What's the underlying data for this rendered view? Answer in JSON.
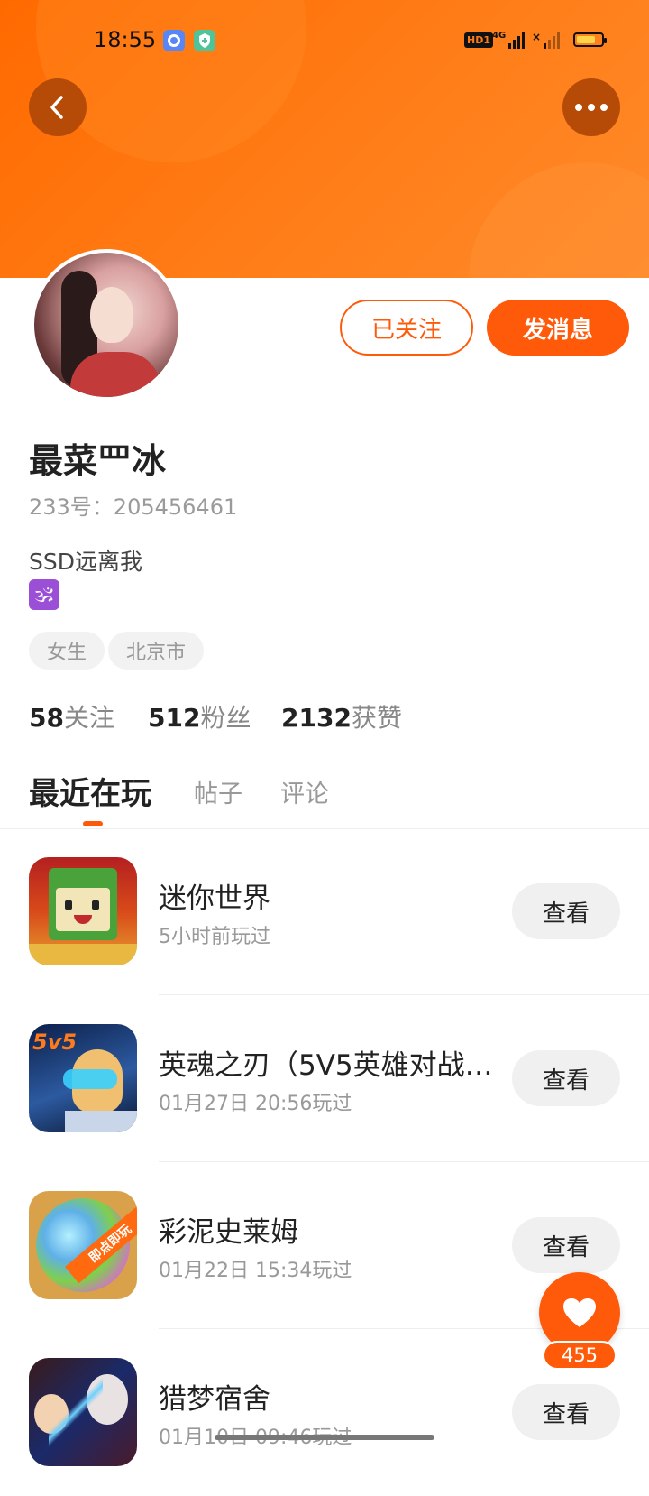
{
  "status_bar": {
    "time": "18:55",
    "hd_label": "HD1",
    "network": "4G",
    "battery_level": 0.75
  },
  "profile": {
    "name": "最菜罒冰",
    "id_text": "233号：205456461",
    "bio": "SSD远离我",
    "bio_emoji": "🕉",
    "tags": [
      "女生",
      "北京市"
    ],
    "follow_label": "已关注",
    "message_label": "发消息"
  },
  "stats": [
    {
      "value": "58",
      "label": "关注"
    },
    {
      "value": "512",
      "label": "粉丝"
    },
    {
      "value": "2132",
      "label": "获赞"
    }
  ],
  "tabs": [
    {
      "label": "最近在玩",
      "active": true
    },
    {
      "label": "帖子",
      "active": false
    },
    {
      "label": "评论",
      "active": false
    }
  ],
  "games": [
    {
      "title": "迷你世界",
      "played": "5小时前玩过",
      "action": "查看"
    },
    {
      "title": "英魂之刃（5V5英雄对战…",
      "played": "01月27日 20:56玩过",
      "action": "查看"
    },
    {
      "title": "彩泥史莱姆",
      "played": "01月22日 15:34玩过",
      "action": "查看",
      "icon_badge": "即点即玩"
    },
    {
      "title": "猎梦宿舍",
      "played": "01月10日 09:46玩过",
      "action": "查看"
    }
  ],
  "game_icon_texts": {
    "ysz": "5v5"
  },
  "like_fab": {
    "count": "455"
  },
  "colors": {
    "accent": "#ff5a0a",
    "header": "#ff7a1a"
  }
}
